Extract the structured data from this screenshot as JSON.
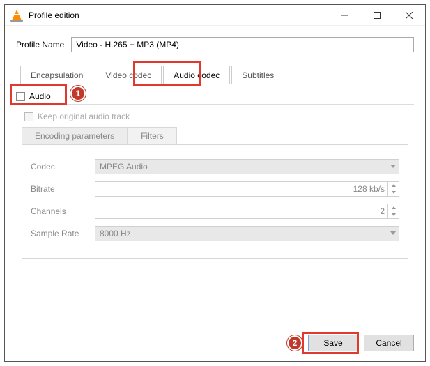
{
  "window": {
    "title": "Profile edition"
  },
  "profile": {
    "label": "Profile Name",
    "value": "Video - H.265 + MP3 (MP4)"
  },
  "tabs": [
    {
      "label": "Encapsulation"
    },
    {
      "label": "Video codec"
    },
    {
      "label": "Audio codec"
    },
    {
      "label": "Subtitles"
    }
  ],
  "active_tab_index": 2,
  "audio": {
    "checkbox_label": "Audio",
    "checked": false,
    "keep_label": "Keep original audio track",
    "keep_checked": false
  },
  "subtabs": [
    {
      "label": "Encoding parameters"
    },
    {
      "label": "Filters"
    }
  ],
  "params": {
    "codec": {
      "label": "Codec",
      "value": "MPEG Audio"
    },
    "bitrate": {
      "label": "Bitrate",
      "value": "128 kb/s"
    },
    "channels": {
      "label": "Channels",
      "value": "2"
    },
    "sample_rate": {
      "label": "Sample Rate",
      "value": "8000 Hz"
    }
  },
  "buttons": {
    "save": "Save",
    "cancel": "Cancel"
  },
  "annotations": {
    "callout1": "1",
    "callout2": "2"
  }
}
